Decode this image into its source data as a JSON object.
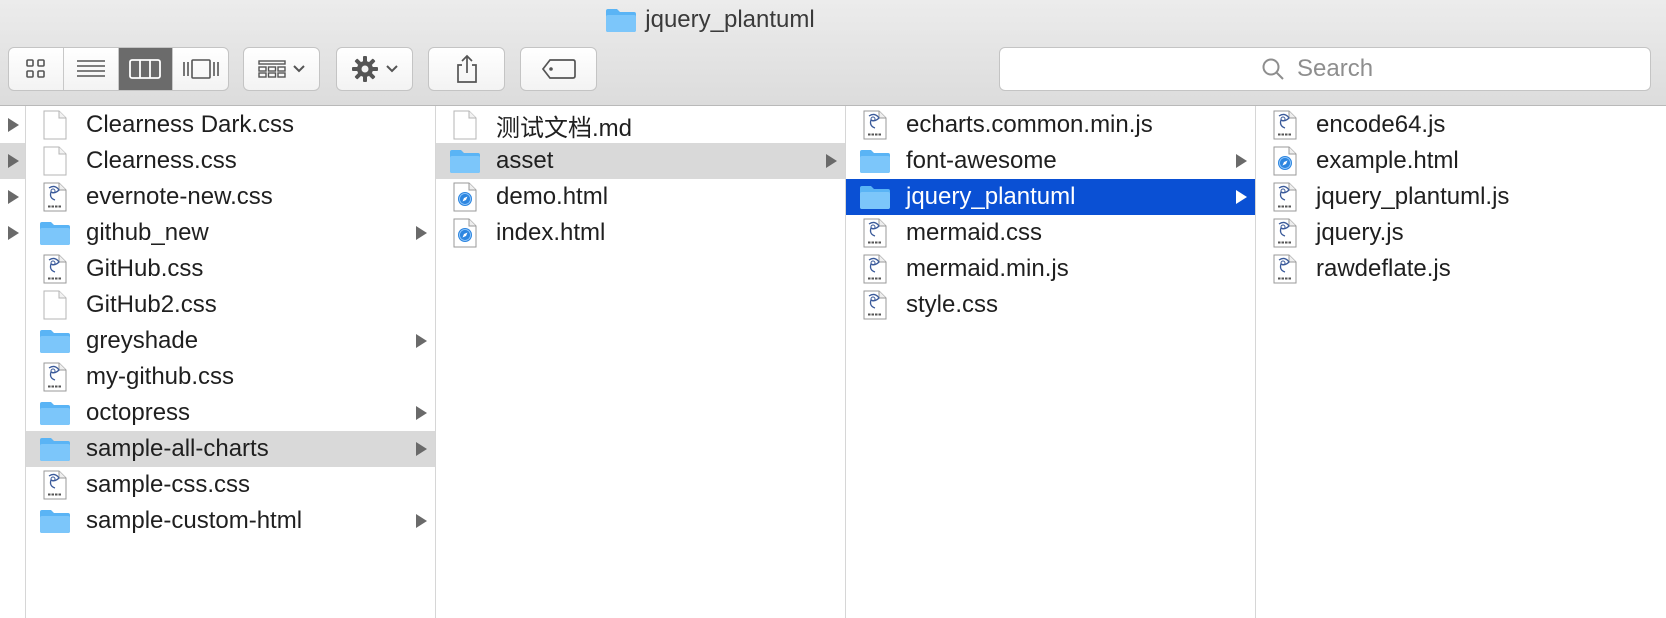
{
  "window": {
    "title": "jquery_plantuml"
  },
  "search": {
    "placeholder": "Search"
  },
  "colors": {
    "selection_blue": "#0a50d4",
    "selection_gray": "#d9d9d9",
    "folder_blue": "#5ab4f5"
  },
  "columns": [
    {
      "items": [
        {
          "name": "Clearness Dark.css",
          "icon": "blank-file-icon",
          "arrow": false
        },
        {
          "name": "Clearness.css",
          "icon": "blank-file-icon",
          "arrow": false
        },
        {
          "name": "evernote-new.css",
          "icon": "text-file-icon",
          "arrow": false
        },
        {
          "name": "github_new",
          "icon": "folder-icon",
          "arrow": true
        },
        {
          "name": "GitHub.css",
          "icon": "text-file-icon",
          "arrow": false
        },
        {
          "name": "GitHub2.css",
          "icon": "blank-file-icon",
          "arrow": false
        },
        {
          "name": "greyshade",
          "icon": "folder-icon",
          "arrow": true
        },
        {
          "name": "my-github.css",
          "icon": "text-file-icon",
          "arrow": false
        },
        {
          "name": "octopress",
          "icon": "folder-icon",
          "arrow": true
        },
        {
          "name": "sample-all-charts",
          "icon": "folder-icon",
          "arrow": true,
          "selected": "gray"
        },
        {
          "name": "sample-css.css",
          "icon": "text-file-icon",
          "arrow": false
        },
        {
          "name": "sample-custom-html",
          "icon": "folder-icon",
          "arrow": true
        }
      ]
    },
    {
      "items": [
        {
          "name": "测试文档.md",
          "icon": "blank-file-icon",
          "arrow": false
        },
        {
          "name": "asset",
          "icon": "folder-icon",
          "arrow": true,
          "selected": "gray"
        },
        {
          "name": "demo.html",
          "icon": "html-file-icon",
          "arrow": false
        },
        {
          "name": "index.html",
          "icon": "html-file-icon",
          "arrow": false
        }
      ]
    },
    {
      "items": [
        {
          "name": "echarts.common.min.js",
          "icon": "text-file-icon",
          "arrow": false
        },
        {
          "name": "font-awesome",
          "icon": "folder-icon",
          "arrow": true
        },
        {
          "name": "jquery_plantuml",
          "icon": "folder-icon",
          "arrow": true,
          "selected": "blue"
        },
        {
          "name": "mermaid.css",
          "icon": "text-file-icon",
          "arrow": false
        },
        {
          "name": "mermaid.min.js",
          "icon": "text-file-icon",
          "arrow": false
        },
        {
          "name": "style.css",
          "icon": "text-file-icon",
          "arrow": false
        }
      ]
    },
    {
      "items": [
        {
          "name": "encode64.js",
          "icon": "text-file-icon",
          "arrow": false
        },
        {
          "name": "example.html",
          "icon": "html-file-icon",
          "arrow": false
        },
        {
          "name": "jquery_plantuml.js",
          "icon": "text-file-icon",
          "arrow": false
        },
        {
          "name": "jquery.js",
          "icon": "text-file-icon",
          "arrow": false
        },
        {
          "name": "rawdeflate.js",
          "icon": "text-file-icon",
          "arrow": false
        }
      ]
    }
  ],
  "parent_column_arrows": [
    true,
    true,
    true,
    true
  ]
}
